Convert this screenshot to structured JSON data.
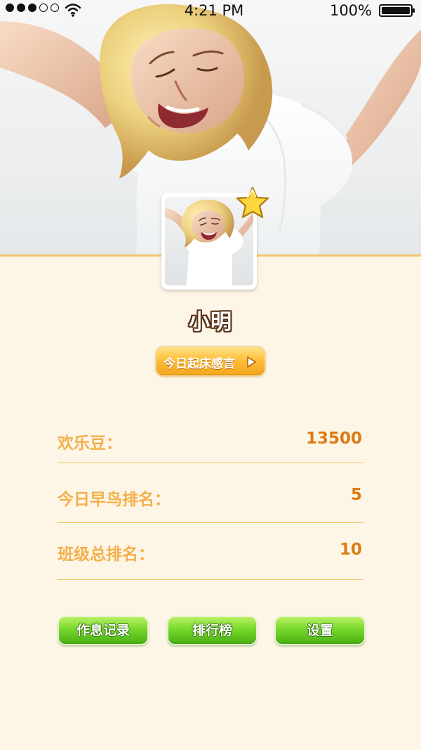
{
  "status_bar": {
    "time": "4:21 PM",
    "battery": "100%",
    "signal_icon": "signal-dots-icon",
    "wifi_icon": "wifi-icon",
    "battery_icon": "battery-full-icon"
  },
  "profile": {
    "name": "小明",
    "wake_message_button": "今日起床感言",
    "avatar_icon": "child-avatar-photo",
    "badge_icon": "star-icon"
  },
  "stats": [
    {
      "label": "欢乐豆：",
      "value": "13500"
    },
    {
      "label": "今日早鸟排名：",
      "value": "5"
    },
    {
      "label": "班级总排名：",
      "value": "10"
    }
  ],
  "actions": [
    {
      "label": "作息记录"
    },
    {
      "label": "排行榜"
    },
    {
      "label": "设置"
    }
  ],
  "colors": {
    "background": "#fdf6e7",
    "accent_orange": "#f3b04b",
    "value_orange": "#db7c10",
    "divider": "#f0c66b",
    "button_green": "#78d92d",
    "button_orange": "#ffbd38"
  }
}
